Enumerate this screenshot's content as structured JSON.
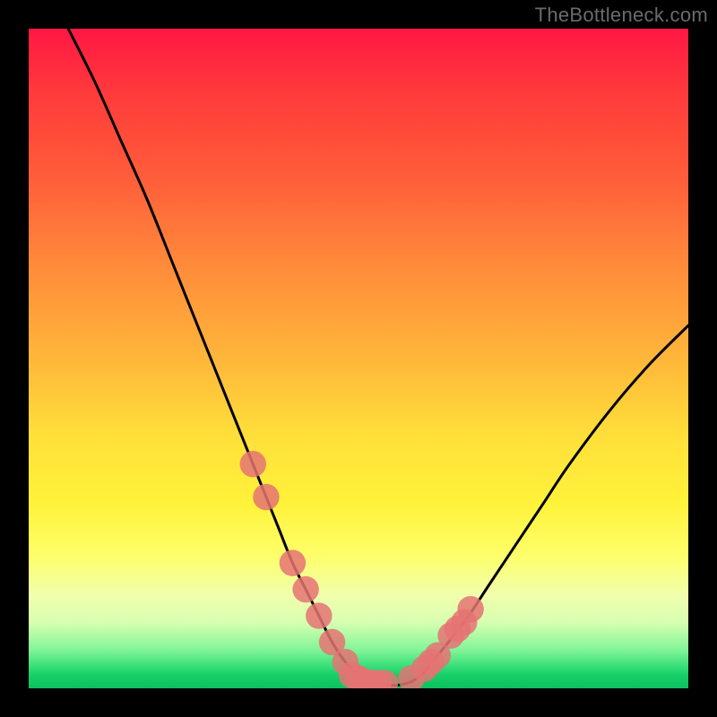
{
  "watermark": {
    "text": "TheBottleneck.com"
  },
  "chart_data": {
    "type": "line",
    "title": "",
    "xlabel": "",
    "ylabel": "",
    "xlim": [
      0,
      100
    ],
    "ylim": [
      0,
      100
    ],
    "gradient_stops": [
      {
        "pct": 0,
        "color": "#ff1744"
      },
      {
        "pct": 22,
        "color": "#ff5b3a"
      },
      {
        "pct": 50,
        "color": "#ffb63a"
      },
      {
        "pct": 72,
        "color": "#fff23a"
      },
      {
        "pct": 90,
        "color": "#d7ffb0"
      },
      {
        "pct": 100,
        "color": "#0cc05e"
      }
    ],
    "series": [
      {
        "name": "bottleneck-curve",
        "color": "#000000",
        "x": [
          6,
          10,
          14,
          18,
          22,
          26,
          30,
          34,
          36,
          38,
          40,
          42,
          44,
          46,
          48,
          50,
          52,
          54,
          56,
          58,
          60,
          62,
          66,
          70,
          74,
          78,
          82,
          88,
          94,
          100
        ],
        "y": [
          100,
          92,
          83,
          74,
          64,
          54,
          44,
          34,
          29,
          24,
          19,
          15,
          11,
          7,
          4,
          2,
          1,
          0.5,
          0.5,
          1,
          2.5,
          5,
          10,
          16,
          22,
          28,
          34,
          42,
          49,
          55
        ]
      }
    ],
    "points": {
      "name": "markers",
      "color": "#e57373",
      "radius": 2.0,
      "x": [
        34,
        36,
        40,
        42,
        44,
        46,
        48,
        49,
        50,
        51,
        52,
        53,
        54,
        58,
        60,
        61,
        62,
        64,
        65,
        66,
        67
      ],
      "y": [
        34,
        29,
        19,
        15,
        11,
        7,
        4,
        2,
        1.5,
        1,
        0.8,
        0.8,
        0.8,
        1.5,
        3,
        4,
        5,
        8,
        9,
        10,
        12
      ]
    }
  }
}
